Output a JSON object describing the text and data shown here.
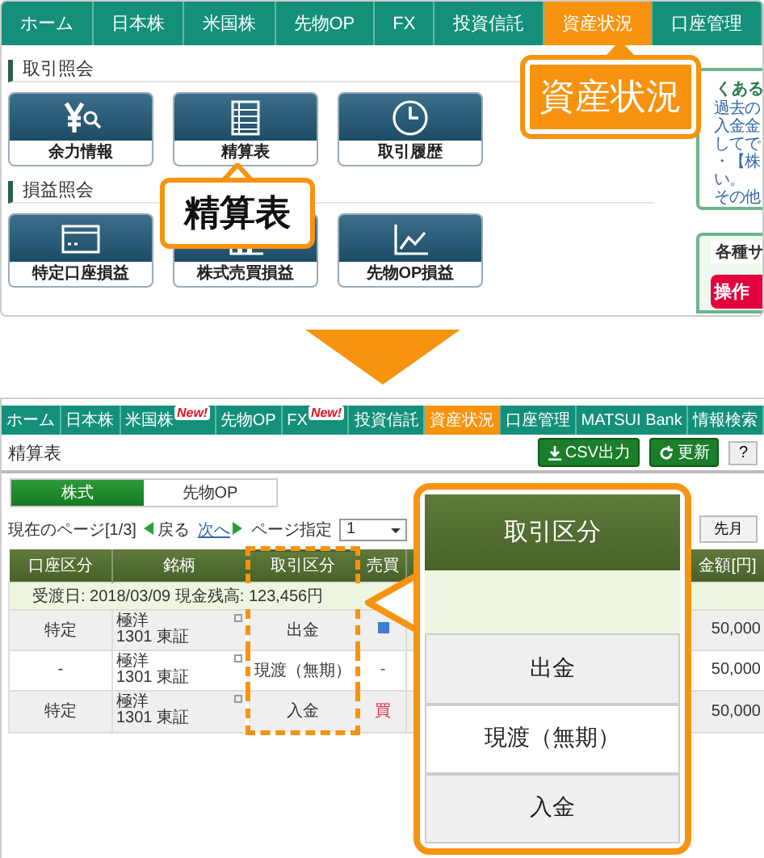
{
  "top_panel": {
    "nav": [
      {
        "label": "ホーム",
        "selected": false
      },
      {
        "label": "日本株",
        "selected": false
      },
      {
        "label": "米国株",
        "selected": false
      },
      {
        "label": "先物OP",
        "selected": false
      },
      {
        "label": "FX",
        "selected": false
      },
      {
        "label": "投資信託",
        "selected": false
      },
      {
        "label": "資産状況",
        "selected": true
      },
      {
        "label": "口座管理",
        "selected": false
      }
    ],
    "sections": [
      {
        "title": "取引照会",
        "tiles": [
          {
            "label": "余力情報"
          },
          {
            "label": "精算表"
          },
          {
            "label": "取引履歴"
          }
        ]
      },
      {
        "title": "損益照会",
        "tiles": [
          {
            "label": "特定口座損益"
          },
          {
            "label": "株式売買損益"
          },
          {
            "label": "先物OP損益"
          }
        ]
      }
    ],
    "sidebar": {
      "heading": "くある",
      "lines": [
        "過去の",
        "入金金",
        "してで",
        "・【株",
        "い。",
        "その他"
      ],
      "support_heading": "各種サ",
      "support_button": "操作"
    },
    "callouts": [
      {
        "text": "資産状況",
        "kind": "filled"
      },
      {
        "text": "精算表",
        "kind": "outlined"
      }
    ]
  },
  "bottom_panel": {
    "nav": [
      {
        "label": "ホーム",
        "selected": false
      },
      {
        "label": "日本株",
        "selected": false
      },
      {
        "label": "米国株",
        "selected": false,
        "badge": "New!"
      },
      {
        "label": "先物OP",
        "selected": false
      },
      {
        "label": "FX",
        "selected": false,
        "badge": "New!"
      },
      {
        "label": "投資信託",
        "selected": false
      },
      {
        "label": "資産状況",
        "selected": true
      },
      {
        "label": "口座管理",
        "selected": false
      },
      {
        "label": "MATSUI Bank",
        "selected": false
      },
      {
        "label": "情報検索",
        "selected": false
      }
    ],
    "title": "精算表",
    "csv_button": "CSV出力",
    "refresh_button": "更新",
    "help_button": "?",
    "tabs": [
      {
        "label": "株式",
        "selected": true
      },
      {
        "label": "先物OP",
        "selected": false
      }
    ],
    "pager": {
      "current": "現在のページ[1/3]",
      "prev": "戻る",
      "next": "次へ",
      "page_label": "ページ指定",
      "page_value": "1",
      "last_month": "先月"
    },
    "table": {
      "columns": [
        {
          "label": "口座区分",
          "highlighted": false
        },
        {
          "label": "銘柄",
          "highlighted": false
        },
        {
          "label": "取引区分",
          "highlighted": true
        },
        {
          "label": "売買",
          "highlighted": false
        },
        {
          "label": "金額[円]",
          "highlighted": false
        }
      ],
      "summary": "受渡日: 2018/03/09   現金残高: 123,456円",
      "rows": [
        {
          "account": "特定",
          "name": "極洋",
          "code": "1301 東証",
          "type": "出金",
          "side": {
            "kind": "mark",
            "color": "#3d7fd0"
          },
          "amount": "50,000"
        },
        {
          "account": "-",
          "name": "極洋",
          "code": "1301 東証",
          "type": "現渡（無期）",
          "side": {
            "kind": "text",
            "text": "-",
            "color": "#555555"
          },
          "amount": "50,000"
        },
        {
          "account": "特定",
          "name": "極洋",
          "code": "1301 東証",
          "type": "入金",
          "side": {
            "kind": "text",
            "text": "買",
            "color": "#e0304a"
          },
          "amount": "50,000"
        }
      ]
    },
    "zoom_callout": {
      "header": "取引区分",
      "items": [
        "出金",
        "現渡（無期）",
        "入金"
      ]
    }
  }
}
